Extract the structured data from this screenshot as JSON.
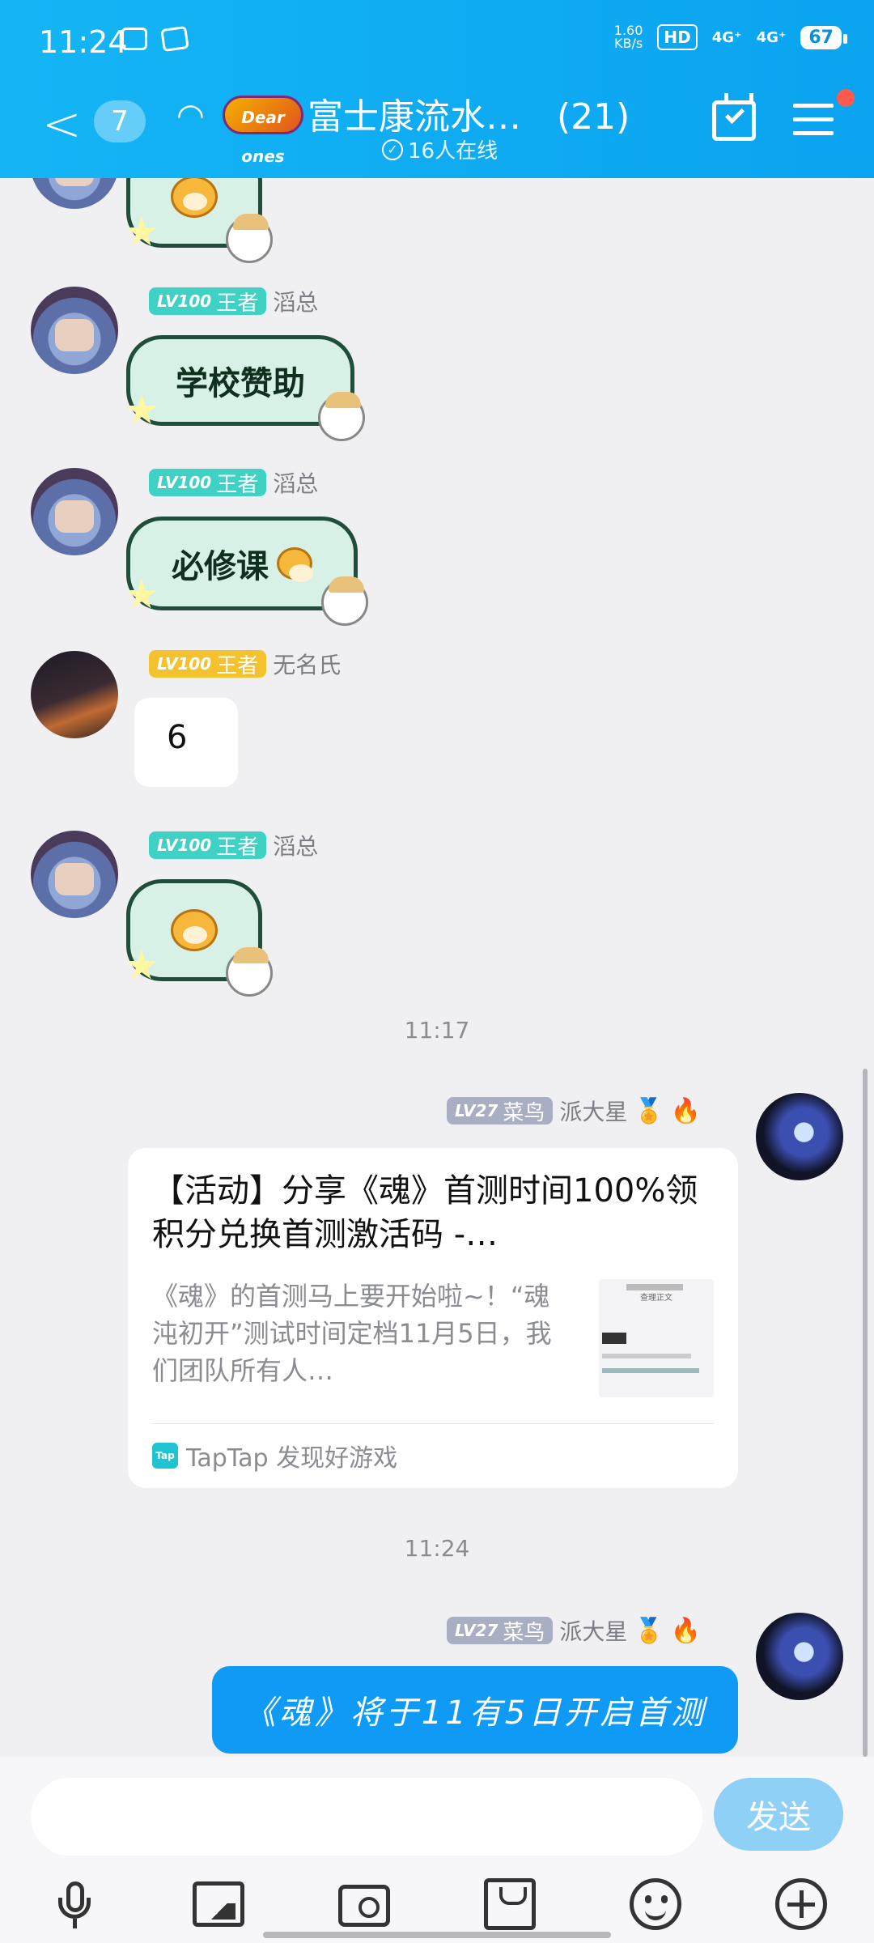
{
  "status_bar": {
    "time": "11:24",
    "net_speed": "1.60",
    "net_unit": "KB/s",
    "hd_label": "HD",
    "sim1": "4G⁺",
    "sim2": "4G⁺",
    "battery": "67"
  },
  "header": {
    "back_count": "7",
    "logo_text": "Dear ones",
    "group_name": "富士康流水…",
    "member_count": "(21)",
    "online_text": "16人在线",
    "has_notification_dot": true
  },
  "messages": [
    {
      "sender": "滔总",
      "badge_level": "LV100",
      "badge_title": "王者",
      "type": "sticker",
      "text": ""
    },
    {
      "sender": "滔总",
      "badge_level": "LV100",
      "badge_title": "王者",
      "type": "sticker",
      "text": "学校赞助"
    },
    {
      "sender": "滔总",
      "badge_level": "LV100",
      "badge_title": "王者",
      "type": "sticker",
      "text": "必修课"
    },
    {
      "sender": "无名氏",
      "badge_level": "LV100",
      "badge_title": "王者",
      "type": "text",
      "text": "6"
    },
    {
      "sender": "滔总",
      "badge_level": "LV100",
      "badge_title": "王者",
      "type": "sticker",
      "text": ""
    }
  ],
  "timestamps": [
    "11:17",
    "11:24"
  ],
  "self_sender": {
    "name": "派大星",
    "badge_level": "LV27",
    "badge_title": "菜鸟",
    "emoji_extra": "🔥"
  },
  "share_card": {
    "title": "【活动】分享《魂》首测时间100%领积分兑换首测激活码 -…",
    "body": "《魂》的首测马上要开始啦~！“魂沌初开”测试时间定档11月5日，我们团队所有人…",
    "thumb_title": "查理正文",
    "source_label": "TapTap 发现好游戏",
    "source_icon_text": "Tap"
  },
  "self_message": "《魂》将于11有5日开启首测",
  "composer": {
    "placeholder": "",
    "send_label": "发送"
  }
}
